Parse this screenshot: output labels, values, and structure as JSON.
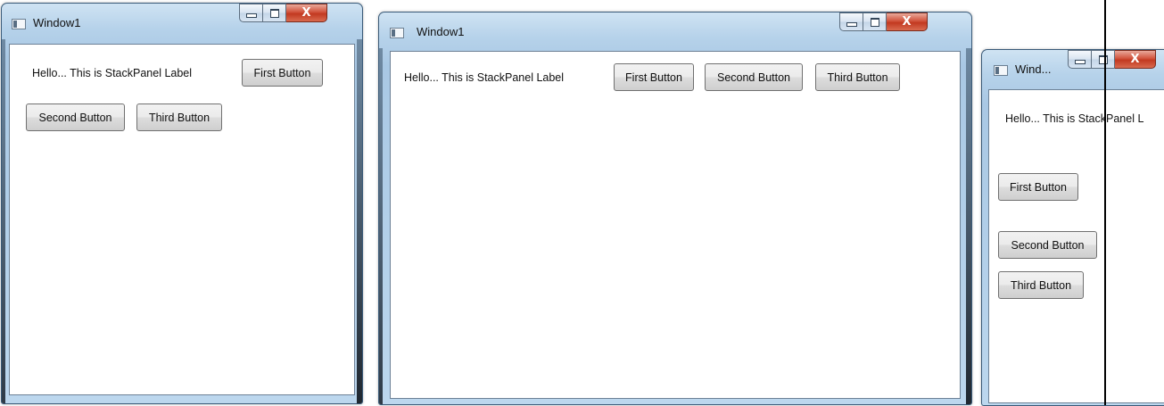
{
  "windows": [
    {
      "title": "Window1",
      "label": "Hello... This is StackPanel Label",
      "buttons": [
        "First Button",
        "Second Button",
        "Third Button"
      ],
      "caption": {
        "minimize": "–",
        "maximize": "□",
        "close": "X"
      }
    },
    {
      "title": "Window1",
      "label": "Hello... This is StackPanel Label",
      "buttons": [
        "First Button",
        "Second Button",
        "Third Button"
      ],
      "caption": {
        "minimize": "–",
        "maximize": "□",
        "close": "X"
      }
    },
    {
      "title": "Wind...",
      "label": "Hello... This is StackPanel L",
      "buttons": [
        "First Button",
        "Second Button",
        "Third Button"
      ],
      "caption": {
        "minimize": "–",
        "maximize": "□",
        "close": "X"
      }
    }
  ],
  "colors": {
    "titlebar": "#b6d2ea",
    "close_button": "#c23920",
    "button_face": "#e6e6e6"
  }
}
